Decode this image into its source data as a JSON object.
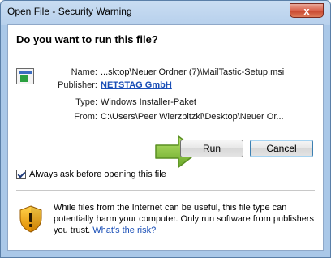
{
  "window": {
    "title": "Open File - Security Warning",
    "close_glyph": "x"
  },
  "dialog": {
    "question": "Do you want to run this file?",
    "file_icon": "msi-file-icon",
    "fields": {
      "name_label": "Name:",
      "name_value": "...sktop\\Neuer Ordner (7)\\MailTastic-Setup.msi",
      "publisher_label": "Publisher:",
      "publisher_value": "NETSTAG GmbH",
      "type_label": "Type:",
      "type_value": "Windows Installer-Paket",
      "from_label": "From:",
      "from_value": "C:\\Users\\Peer Wierzbitzki\\Desktop\\Neuer Or..."
    },
    "buttons": {
      "run_label": "Run",
      "cancel_label": "Cancel"
    },
    "annotation_arrow_color": "#8dc63f",
    "checkbox": {
      "label": "Always ask before opening this file",
      "checked": true
    },
    "warning": {
      "icon": "shield-warning-icon",
      "text": "While files from the Internet can be useful, this file type can potentially harm your computer. Only run software from publishers you trust. ",
      "link": "What's the risk?"
    }
  }
}
